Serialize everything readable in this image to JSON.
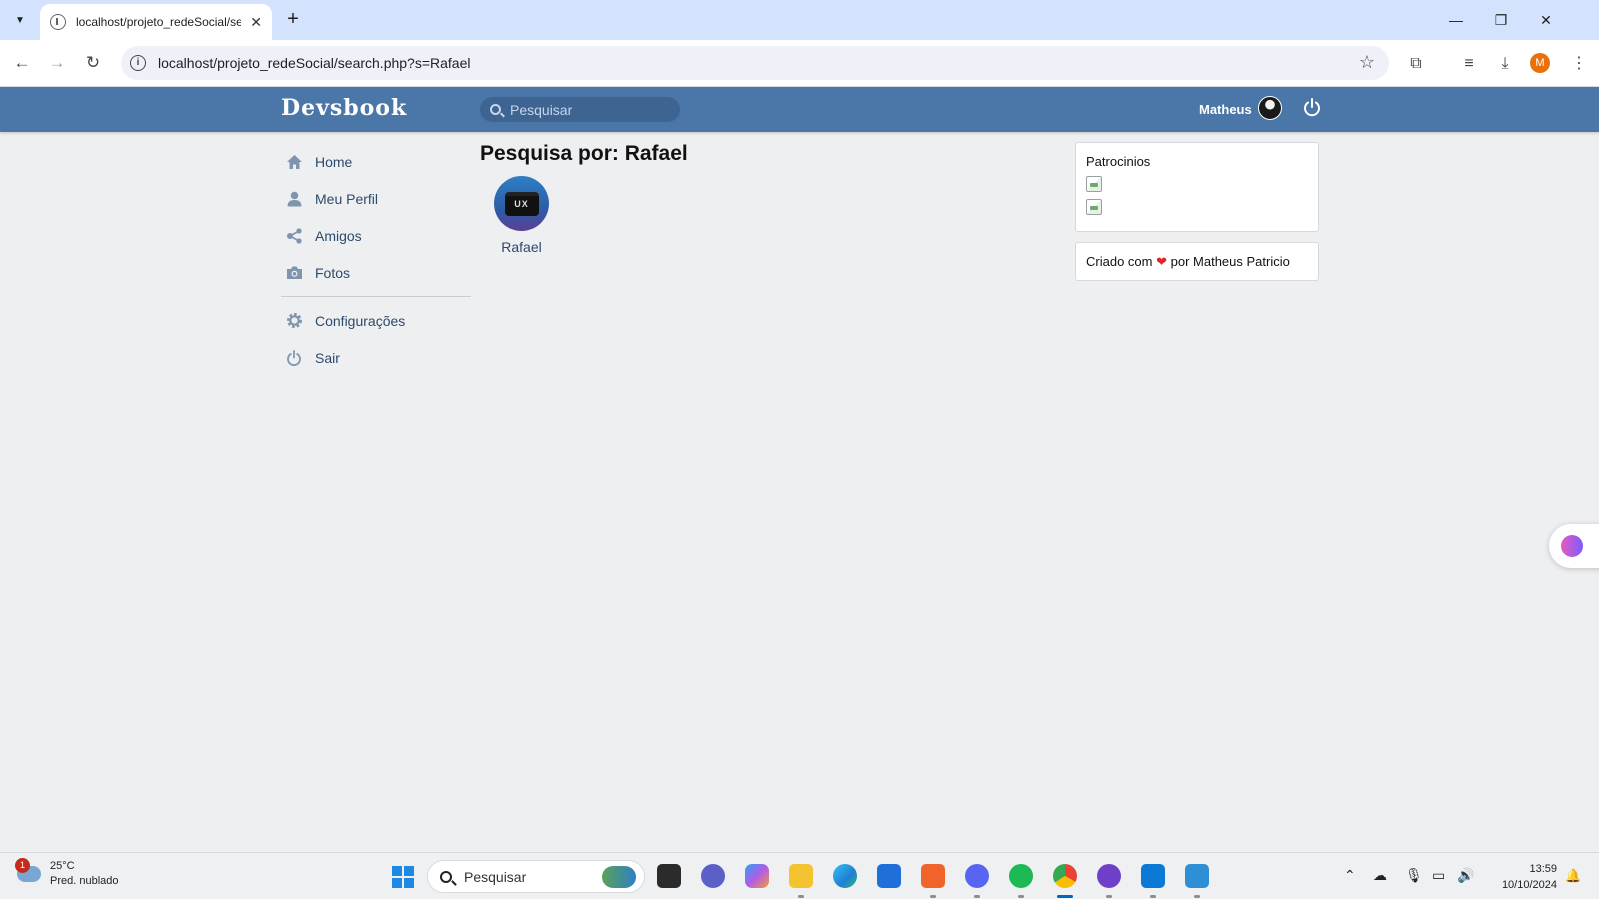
{
  "browser": {
    "tab_title": "localhost/projeto_redeSocial/se",
    "url": "localhost/projeto_redeSocial/search.php?s=Rafael",
    "profile_initial": "M"
  },
  "site": {
    "logo": "Devsbook",
    "search_placeholder": "Pesquisar",
    "user_name": "Matheus",
    "brand_color": "#4a76a8"
  },
  "menu": {
    "items": [
      {
        "label": "Home",
        "icon": "home-icon"
      },
      {
        "label": "Meu Perfil",
        "icon": "user-icon"
      },
      {
        "label": "Amigos",
        "icon": "friends-icon"
      },
      {
        "label": "Fotos",
        "icon": "camera-icon"
      }
    ],
    "secondary": [
      {
        "label": "Configurações",
        "icon": "gear-icon"
      },
      {
        "label": "Sair",
        "icon": "power-icon"
      }
    ]
  },
  "main": {
    "title": "Pesquisa por: Rafael",
    "results": [
      {
        "name": "Rafael",
        "avatar_text": "UX"
      }
    ]
  },
  "sidebar": {
    "sponsors_title": "Patrocinios",
    "footer_prefix": "Criado com",
    "footer_heart": "❤",
    "footer_suffix": "por Matheus Patricio"
  },
  "taskbar": {
    "weather_badge": "1",
    "temperature": "25°C",
    "condition": "Pred. nublado",
    "search_label": "Pesquisar",
    "time": "13:59",
    "date": "10/10/2024"
  }
}
